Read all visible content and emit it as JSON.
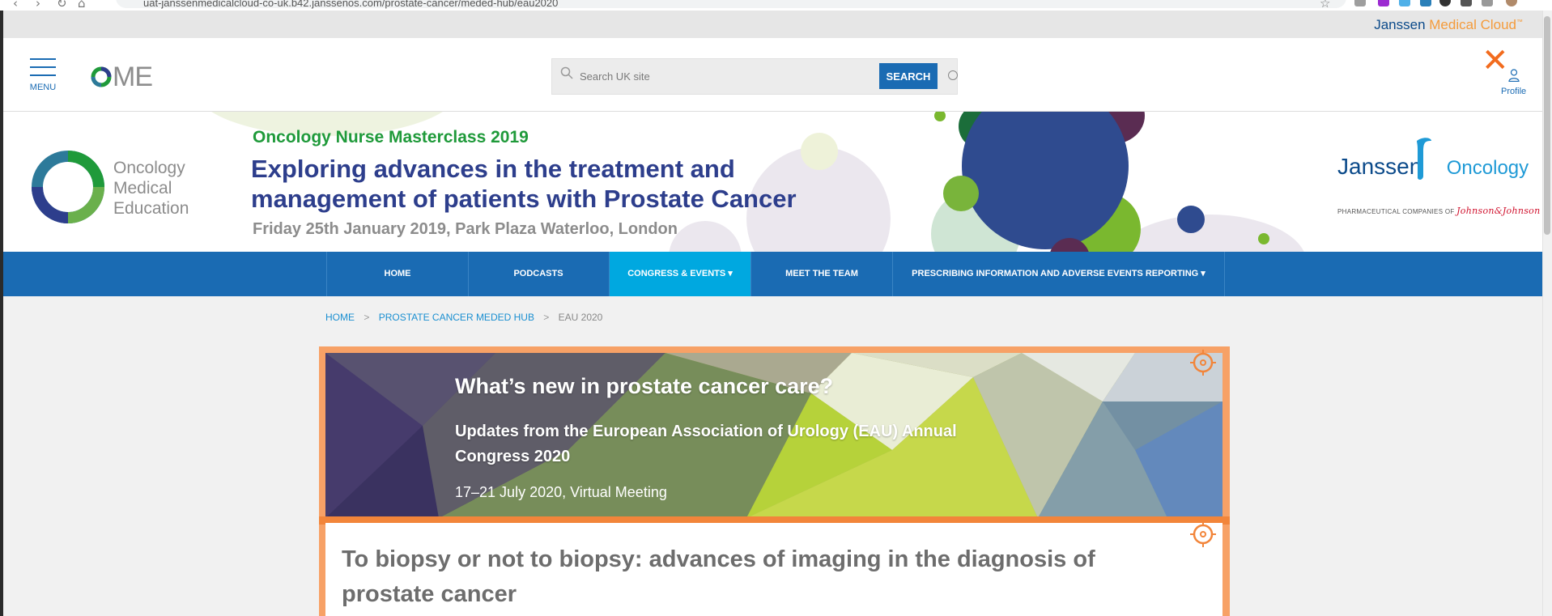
{
  "browser": {
    "url": "uat-janssenmedicalcloud-co-uk.b42.janssenos.com/prostate-cancer/meded-hub/eau2020"
  },
  "brand_strip": {
    "janssen": "Janssen",
    "medical_cloud": "Medical Cloud",
    "tm": "™"
  },
  "header": {
    "menu_label": "MENU",
    "logo_text": "ME",
    "search": {
      "placeholder": "Search UK site",
      "button_label": "SEARCH"
    },
    "close_symbol": "✕",
    "profile_label": "Profile"
  },
  "hero": {
    "brand_text": [
      "Oncology",
      "Medical",
      "Education"
    ],
    "kicker": "Oncology Nurse Masterclass 2019",
    "title_line1": "Exploring advances in the treatment and",
    "title_line2": "management of patients with Prostate Cancer",
    "date": "Friday 25th January 2019, Park Plaza Waterloo, London",
    "sponsor_janssen": "Janssen",
    "sponsor_oncology": "Oncology",
    "pharma_prefix": "PHARMACEUTICAL COMPANIES OF",
    "pharma_jj": "Johnson&Johnson"
  },
  "nav": {
    "items": [
      {
        "label": "HOME"
      },
      {
        "label": "PODCASTS"
      },
      {
        "label": "CONGRESS & EVENTS ▾"
      },
      {
        "label": "MEET THE TEAM"
      },
      {
        "label": "PRESCRIBING INFORMATION AND ADVERSE EVENTS REPORTING ▾"
      }
    ]
  },
  "breadcrumb": {
    "items": [
      "HOME",
      "PROSTATE CANCER MEDED HUB",
      "EAU 2020"
    ],
    "separator": ">"
  },
  "eau_banner": {
    "heading": "What’s new in prostate cancer care?",
    "subheading": "Updates from the European Association of Urology (EAU) Annual Congress 2020",
    "date": "17–21 July 2020, Virtual Meeting"
  },
  "card": {
    "title": "To biopsy or not to biopsy: advances of imaging in the diagnosis of prostate cancer"
  },
  "colors": {
    "primary_blue": "#1a6bb3",
    "active_nav": "#00a8e0",
    "accent_orange": "#f26b1d",
    "title_navy": "#2d3e8c",
    "kicker_green": "#1f9a3a"
  }
}
